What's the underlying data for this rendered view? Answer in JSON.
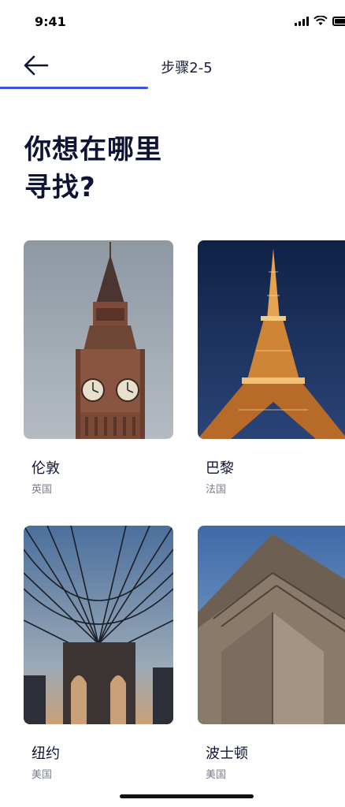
{
  "status_bar": {
    "time": "9:41"
  },
  "header": {
    "step_label": "步骤2-5",
    "progress": 0.43
  },
  "question": "你想在哪里\n寻找?",
  "cities": [
    {
      "name": "伦敦",
      "country": "英国",
      "image": "big-ben-clock-tower"
    },
    {
      "name": "巴黎",
      "country": "法国",
      "image": "eiffel-tower-night"
    },
    {
      "name": "纽约",
      "country": "美国",
      "image": "brooklyn-bridge"
    },
    {
      "name": "波士顿",
      "country": "美国",
      "image": "concrete-building"
    }
  ],
  "colors": {
    "accent": "#3b54e0",
    "heading": "#0e1433",
    "subtext": "#7a7d8c"
  }
}
